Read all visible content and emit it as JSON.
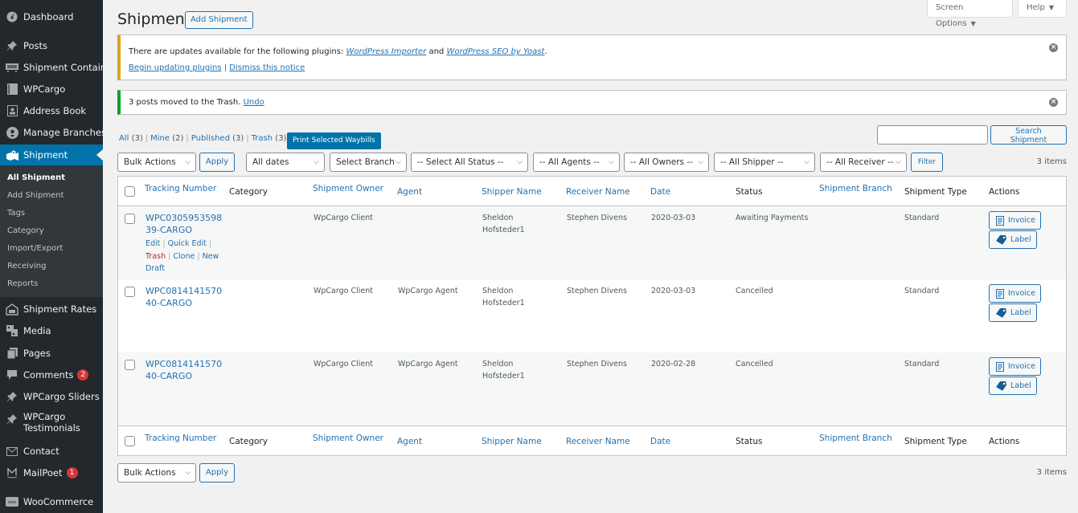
{
  "sidebar": {
    "items": [
      {
        "label": "Dashboard",
        "icon": "dashboard-icon"
      },
      {
        "label": "Posts",
        "icon": "pin-icon"
      },
      {
        "label": "Shipment Container",
        "icon": "container-icon"
      },
      {
        "label": "WPCargo",
        "icon": "book-icon"
      },
      {
        "label": "Address Book",
        "icon": "address-book-icon"
      },
      {
        "label": "Manage Branches",
        "icon": "location-icon"
      },
      {
        "label": "Shipment",
        "icon": "shipment-map-icon",
        "active": true
      },
      {
        "label": "Shipment Rates",
        "icon": "rates-icon"
      },
      {
        "label": "Media",
        "icon": "media-icon"
      },
      {
        "label": "Pages",
        "icon": "pages-icon"
      },
      {
        "label": "Comments",
        "icon": "comment-icon",
        "badge": "2"
      },
      {
        "label": "WPCargo Sliders",
        "icon": "pin-icon"
      },
      {
        "label": "WPCargo Testimonials",
        "icon": "pin-icon"
      },
      {
        "label": "Contact",
        "icon": "mail-icon"
      },
      {
        "label": "MailPoet",
        "icon": "mailpoet-icon",
        "badge": "1"
      },
      {
        "label": "WooCommerce",
        "icon": "woo-icon"
      }
    ],
    "submenu": [
      {
        "label": "All Shipment",
        "current": true
      },
      {
        "label": "Add Shipment"
      },
      {
        "label": "Tags"
      },
      {
        "label": "Category"
      },
      {
        "label": "Import/Export"
      },
      {
        "label": "Receiving"
      },
      {
        "label": "Reports"
      }
    ]
  },
  "header": {
    "title": "Shipment",
    "add_button": "Add Shipment",
    "screen_options": "Screen Options",
    "help": "Help"
  },
  "notices": {
    "update": {
      "text_before": "There are updates available for the following plugins: ",
      "plugin1": "WordPress Importer",
      "and": " and ",
      "plugin2": "WordPress SEO by Yoast",
      "period": ".",
      "begin_link": "Begin updating plugins",
      "pipe": " | ",
      "dismiss_link": "Dismiss this notice"
    },
    "trash": {
      "text": "3 posts moved to the Trash. ",
      "undo": "Undo"
    }
  },
  "views": [
    {
      "label": "All",
      "count": "(3)"
    },
    {
      "label": "Mine",
      "count": "(2)"
    },
    {
      "label": "Published",
      "count": "(3)"
    },
    {
      "label": "Trash",
      "count": "(3)"
    }
  ],
  "print_waybills": "Print Selected Waybills",
  "search": {
    "value": "",
    "button": "Search Shipment"
  },
  "filters": {
    "bulk_actions": "Bulk Actions",
    "apply": "Apply",
    "dates": "All dates",
    "branch": "Select Branch",
    "status": "-- Select All Status --",
    "agents": "-- All Agents --",
    "owners": "-- All Owners --",
    "shipper": "-- All Shipper --",
    "receiver": "-- All Receiver --",
    "filter": "Filter",
    "items_count": "3 items"
  },
  "table": {
    "columns": [
      {
        "label": "Tracking Number",
        "sortable": true
      },
      {
        "label": "Category",
        "sortable": false
      },
      {
        "label": "Shipment Owner",
        "sortable": true
      },
      {
        "label": "Agent",
        "sortable": true
      },
      {
        "label": "Shipper Name",
        "sortable": true
      },
      {
        "label": "Receiver Name",
        "sortable": true
      },
      {
        "label": "Date",
        "sortable": true
      },
      {
        "label": "Status",
        "sortable": false
      },
      {
        "label": "Shipment Branch",
        "sortable": true
      },
      {
        "label": "Shipment Type",
        "sortable": false
      },
      {
        "label": "Actions",
        "sortable": false
      }
    ],
    "rows": [
      {
        "tracking_line1": "WPC0305953598",
        "tracking_line2": "39-CARGO",
        "category": "",
        "owner": "WpCargo Client",
        "agent": "",
        "shipper_line1": "Sheldon",
        "shipper_line2": "Hofsteder1",
        "receiver": "Stephen Divens",
        "date": "2020-03-03",
        "status": "Awaiting Payments",
        "branch": "",
        "type": "Standard"
      },
      {
        "tracking_line1": "WPC0814141570",
        "tracking_line2": "40-CARGO",
        "category": "",
        "owner": "WpCargo Client",
        "agent": "WpCargo Agent",
        "shipper_line1": "Sheldon",
        "shipper_line2": "Hofsteder1",
        "receiver": "Stephen Divens",
        "date": "2020-03-03",
        "status": "Cancelled",
        "branch": "",
        "type": "Standard"
      },
      {
        "tracking_line1": "WPC0814141570",
        "tracking_line2": "40-CARGO",
        "category": "",
        "owner": "WpCargo Client",
        "agent": "WpCargo Agent",
        "shipper_line1": "Sheldon",
        "shipper_line2": "Hofsteder1",
        "receiver": "Stephen Divens",
        "date": "2020-02-28",
        "status": "Cancelled",
        "branch": "",
        "type": "Standard"
      }
    ],
    "row_actions": {
      "edit": "Edit",
      "quick_edit": "Quick Edit",
      "trash": "Trash",
      "clone": "Clone",
      "new_draft_1": "New",
      "new_draft_2": "Draft"
    },
    "action_buttons": {
      "invoice": "Invoice",
      "label": "Label"
    }
  },
  "colors": {
    "sidebar_bg": "#23282d",
    "submenu_bg": "#32373c",
    "accent": "#0073aa",
    "link": "#2271b1",
    "warning": "#dba617",
    "success": "#00a32a",
    "badge": "#d63638",
    "trash": "#b32d2e"
  }
}
